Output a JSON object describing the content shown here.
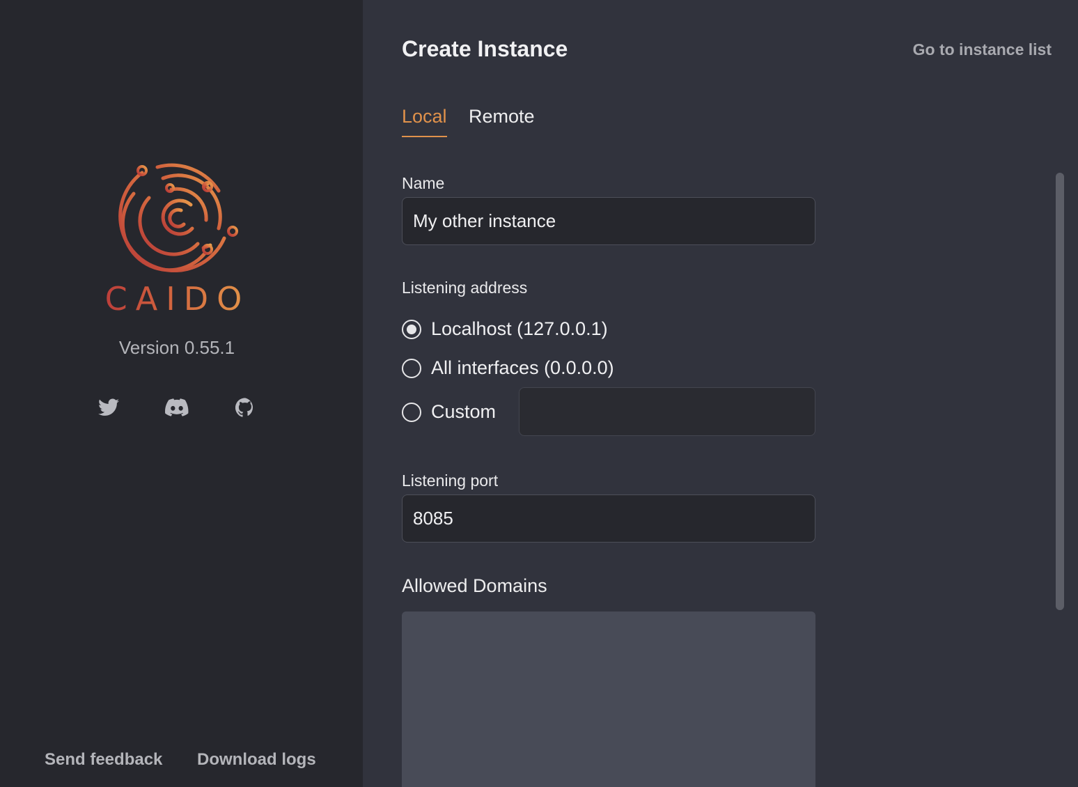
{
  "sidebar": {
    "brand": "CAIDO",
    "version": "Version 0.55.1",
    "social": [
      {
        "name": "twitter-icon"
      },
      {
        "name": "discord-icon"
      },
      {
        "name": "github-icon"
      }
    ],
    "send_feedback": "Send feedback",
    "download_logs": "Download logs"
  },
  "header": {
    "title": "Create Instance",
    "goto_list": "Go to instance list"
  },
  "tabs": [
    {
      "label": "Local",
      "active": true
    },
    {
      "label": "Remote",
      "active": false
    }
  ],
  "form": {
    "name_label": "Name",
    "name_value": "My other instance",
    "address_label": "Listening address",
    "address_options": [
      {
        "label": "Localhost (127.0.0.1)",
        "checked": true
      },
      {
        "label": "All interfaces (0.0.0.0)",
        "checked": false
      },
      {
        "label": "Custom",
        "checked": false
      }
    ],
    "custom_value": "",
    "port_label": "Listening port",
    "port_value": "8085",
    "domains_label": "Allowed Domains"
  },
  "colors": {
    "accent": "#e1924b",
    "sidebar_bg": "#26272d",
    "main_bg": "#31333d"
  }
}
